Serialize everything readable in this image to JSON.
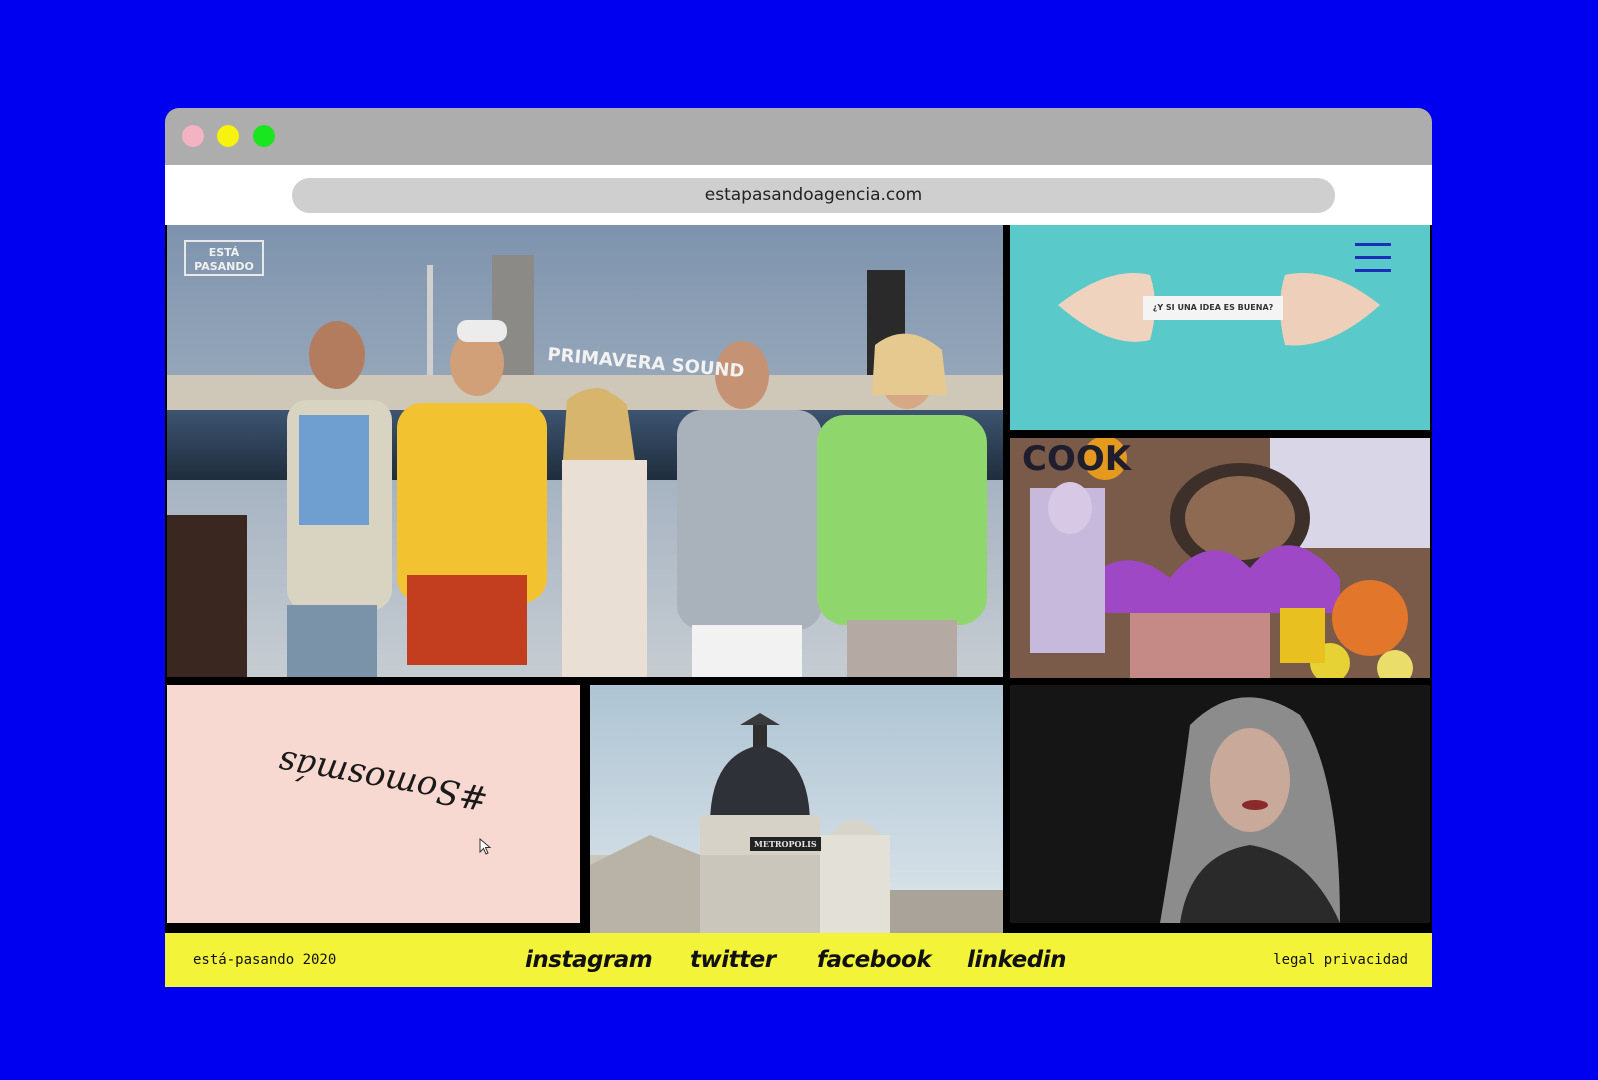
{
  "colors": {
    "background": "#0000f0",
    "footer": "#f3f33a",
    "titlebar": "#adadad",
    "dot_close": "#f4b3c2",
    "dot_min": "#f6f30f",
    "dot_max": "#19e61e",
    "teal_tile": "#59c9ca",
    "pink_tile": "#f8d9d1",
    "menu_accent": "#1c2fb8"
  },
  "browser": {
    "url": "estapasandoagencia.com"
  },
  "hero": {
    "logo_line1": "ESTÁ",
    "logo_line2": "PASANDO",
    "sign": "PRIMAVERA SOUND"
  },
  "menu": {
    "icon": "hamburger-icon"
  },
  "fortune": {
    "label": "¿Y SI UNA IDEA ES BUENA?"
  },
  "collage": {
    "letters": "COOK"
  },
  "pink_tile": {
    "text": "#Somosmás"
  },
  "metropolis": {
    "sign": "METROPOLIS"
  },
  "footer": {
    "copyright": "está-pasando 2020",
    "social": [
      "instagram",
      "twitter",
      "facebook",
      "linkedin"
    ],
    "legal": "legal privacidad"
  }
}
